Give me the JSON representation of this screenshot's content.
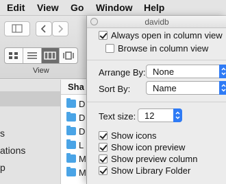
{
  "menubar": {
    "items": [
      "Edit",
      "View",
      "Go",
      "Window",
      "Help"
    ]
  },
  "finder": {
    "view_label": "View",
    "view_modes": [
      "icon-view",
      "list-view",
      "column-view",
      "cover-flow-view"
    ],
    "selected_view": "column-view",
    "sidebar_items": [
      "s",
      "ations",
      "p"
    ],
    "list_header": "Sha",
    "files": [
      "D",
      "D",
      "D",
      "L",
      "M",
      "M"
    ]
  },
  "panel": {
    "title": "davidb",
    "always_open": {
      "label": "Always open in column view",
      "checked": true
    },
    "browse": {
      "label": "Browse in column view",
      "checked": false
    },
    "arrange_by": {
      "label": "Arrange By:",
      "value": "None"
    },
    "sort_by": {
      "label": "Sort By:",
      "value": "Name"
    },
    "text_size": {
      "label": "Text size:",
      "value": "12"
    },
    "options": [
      {
        "label": "Show icons",
        "checked": true
      },
      {
        "label": "Show icon preview",
        "checked": true
      },
      {
        "label": "Show preview column",
        "checked": true
      },
      {
        "label": "Show Library Folder",
        "checked": true
      }
    ]
  },
  "colors": {
    "accent": "#2f7bf5",
    "folder": "#4aa4e6"
  }
}
